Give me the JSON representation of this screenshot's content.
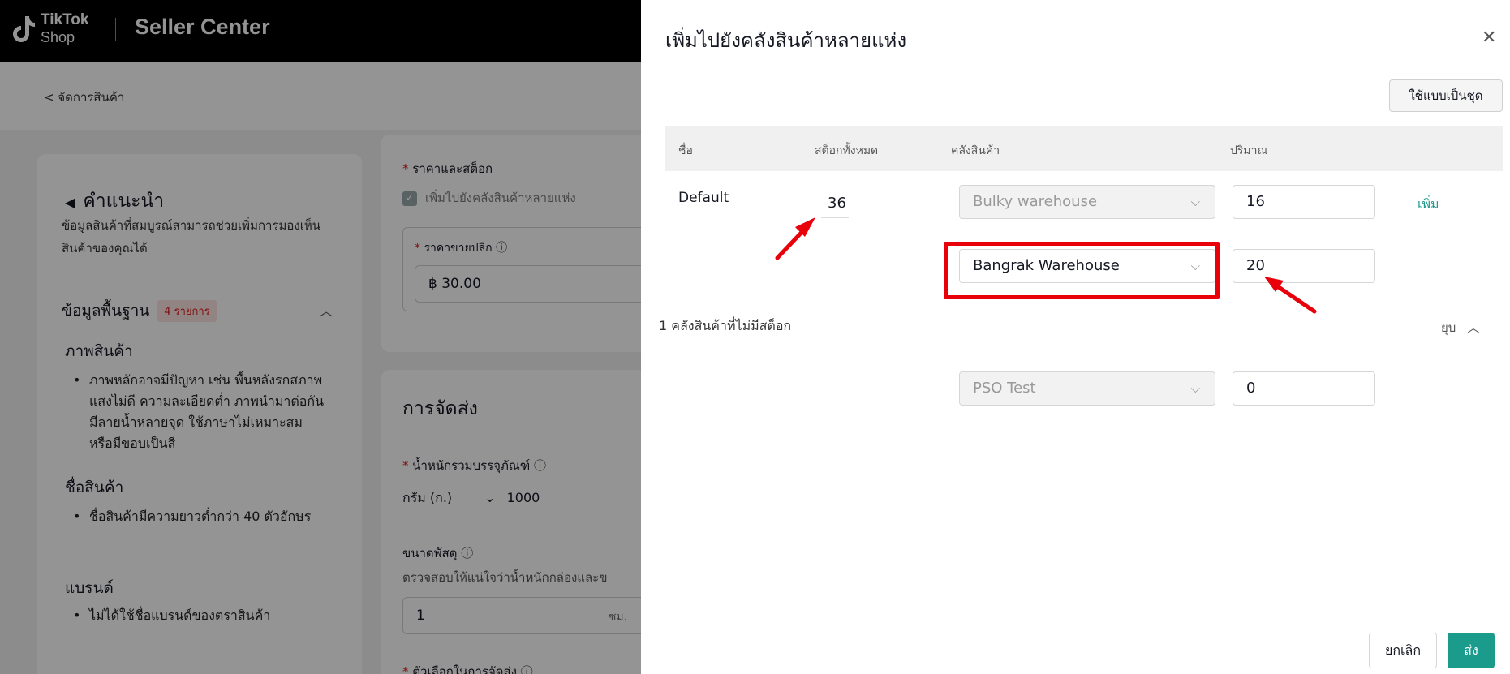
{
  "app": {
    "logo_line1": "TikTok",
    "logo_line2": "Shop",
    "title": "Seller Center"
  },
  "breadcrumb": {
    "back_label": "< จัดการสินค้า"
  },
  "guide": {
    "title": "คำแนะนำ",
    "description": "ข้อมูลสินค้าที่สมบูรณ์สามารถช่วยเพิ่มการมองเห็นสินค้าของคุณได้",
    "basic_info": "ข้อมูลพื้นฐาน",
    "basic_badge": "4 รายการ",
    "sections": [
      {
        "heading": "ภาพสินค้า",
        "text": "ภาพหลักอาจมีปัญหา เช่น พื้นหลังรกสภาพแสงไม่ดี ความละเอียดต่ำ ภาพนำมาต่อกัน มีลายน้ำหลายจุด ใช้ภาษาไม่เหมาะสม หรือมีขอบเป็นสี"
      },
      {
        "heading": "ชื่อสินค้า",
        "text": "ชื่อสินค้ามีความยาวต่ำกว่า 40 ตัวอักษร"
      },
      {
        "heading": "แบรนด์",
        "text": "ไม่ได้ใช้ชื่อแบรนด์ของตราสินค้า"
      }
    ]
  },
  "price_stock": {
    "label": "ราคาและสต็อก",
    "multi_warehouse_label": "เพิ่มไปยังคลังสินค้าหลายแห่ง",
    "retail_price_label": "ราคาขายปลีก",
    "retail_price_value": "฿  30.00"
  },
  "shipping": {
    "title": "การจัดส่ง",
    "weight_label": "น้ำหนักรวมบรรจุภัณฑ์",
    "weight_unit": "กรัม (ก.)",
    "weight_value": "1000",
    "size_label": "ขนาดพัสดุ",
    "size_hint": "ตรวจสอบให้แน่ใจว่าน้ำหนักกล่องและข",
    "size_value": "1",
    "size_unit": "ซม.",
    "options_label": "ตัวเลือกในการจัดส่ง"
  },
  "drawer": {
    "title": "เพิ่มไปยังคลังสินค้าหลายแห่ง",
    "batch_button": "ใช้แบบเป็นชุด",
    "columns": [
      "ชื่อ",
      "สต็อกทั้งหมด",
      "คลังสินค้า",
      "ปริมาณ"
    ],
    "row": {
      "name": "Default",
      "total_stock": "36",
      "warehouses": [
        {
          "name": "Bulky warehouse",
          "qty": "16"
        },
        {
          "name": "Bangrak Warehouse",
          "qty": "20"
        }
      ],
      "add_label": "เพิ่ม"
    },
    "no_stock_label": "1 คลังสินค้าที่ไม่มีสต็อก",
    "collapse_label": "ยุบ",
    "no_stock_warehouse": {
      "name": "PSO Test",
      "qty": "0"
    },
    "cancel_label": "ยกเลิก",
    "send_label": "ส่ง"
  },
  "colors": {
    "accent": "#1a9b8c",
    "highlight": "#e8000b",
    "required": "#e02020"
  }
}
